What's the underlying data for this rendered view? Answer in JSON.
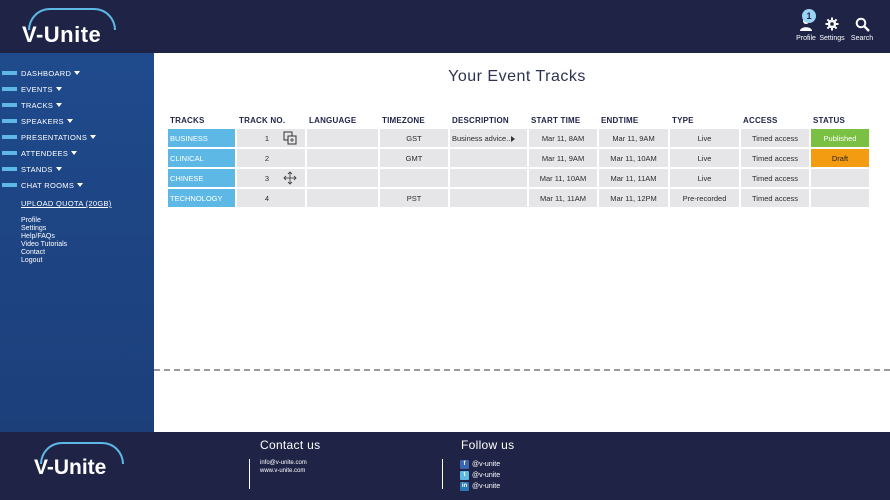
{
  "app": {
    "logo_text": "V-Unite",
    "colors": {
      "header_bg": "#1f2447",
      "sidebar_bg": "#1f4a8c",
      "accent": "#5eb8e6",
      "published": "#7ac143",
      "draft": "#f39c12"
    }
  },
  "header": {
    "profile": {
      "label": "Profile",
      "badge": "1",
      "icon": "user-icon"
    },
    "settings": {
      "label": "Settings",
      "icon": "gear-icon"
    },
    "search": {
      "label": "Search",
      "icon": "search-icon"
    }
  },
  "sidebar": {
    "items": [
      {
        "label": "DASHBOARD"
      },
      {
        "label": "EVENTS"
      },
      {
        "label": "TRACKS"
      },
      {
        "label": "SPEAKERS"
      },
      {
        "label": "PRESENTATIONS"
      },
      {
        "label": "ATTENDEES"
      },
      {
        "label": "STANDS"
      },
      {
        "label": "CHAT ROOMS"
      }
    ],
    "quota": "UPLOAD QUOTA (20GB)",
    "links": [
      "Profile",
      "Settings",
      "Help/FAQs",
      "Video Tutorials",
      "Contact",
      "Logout"
    ]
  },
  "main": {
    "title": "Your Event Tracks",
    "columns": [
      "TRACKS",
      "TRACK NO.",
      "LANGUAGE",
      "TIMEZONE",
      "DESCRIPTION",
      "START TIME",
      "ENDTIME",
      "TYPE",
      "ACCESS",
      "STATUS"
    ],
    "rows": [
      {
        "track": "BUSINESS",
        "no": "1",
        "language": "",
        "timezone": "GST",
        "description": "Business advice..",
        "start": "Mar 11, 8AM",
        "end": "Mar 11, 9AM",
        "type": "Live",
        "access": "Timed access",
        "status": "Published"
      },
      {
        "track": "CLINICAL",
        "no": "2",
        "language": "",
        "timezone": "GMT",
        "description": "",
        "start": "Mar 11, 9AM",
        "end": "Mar 11, 10AM",
        "type": "Live",
        "access": "Timed access",
        "status": "Draft"
      },
      {
        "track": "CHINESE",
        "no": "3",
        "language": "",
        "timezone": "",
        "description": "",
        "start": "Mar 11, 10AM",
        "end": "Mar 11, 11AM",
        "type": "Live",
        "access": "Timed access",
        "status": ""
      },
      {
        "track": "TECHNOLOGY",
        "no": "4",
        "language": "",
        "timezone": "PST",
        "description": "",
        "start": "Mar 11, 11AM",
        "end": "Mar 11, 12PM",
        "type": "Pre-recorded",
        "access": "Timed access",
        "status": ""
      }
    ]
  },
  "footer": {
    "logo_text": "V-Unite",
    "contact_title": "Contact us",
    "email": "info@v-unite.com",
    "website": "www.v-unite.com",
    "follow_title": "Follow us",
    "social": [
      {
        "icon": "facebook-icon",
        "handle": "@v-unite"
      },
      {
        "icon": "twitter-icon",
        "handle": "@v-unite"
      },
      {
        "icon": "linkedin-icon",
        "handle": "@v-unite"
      }
    ]
  }
}
